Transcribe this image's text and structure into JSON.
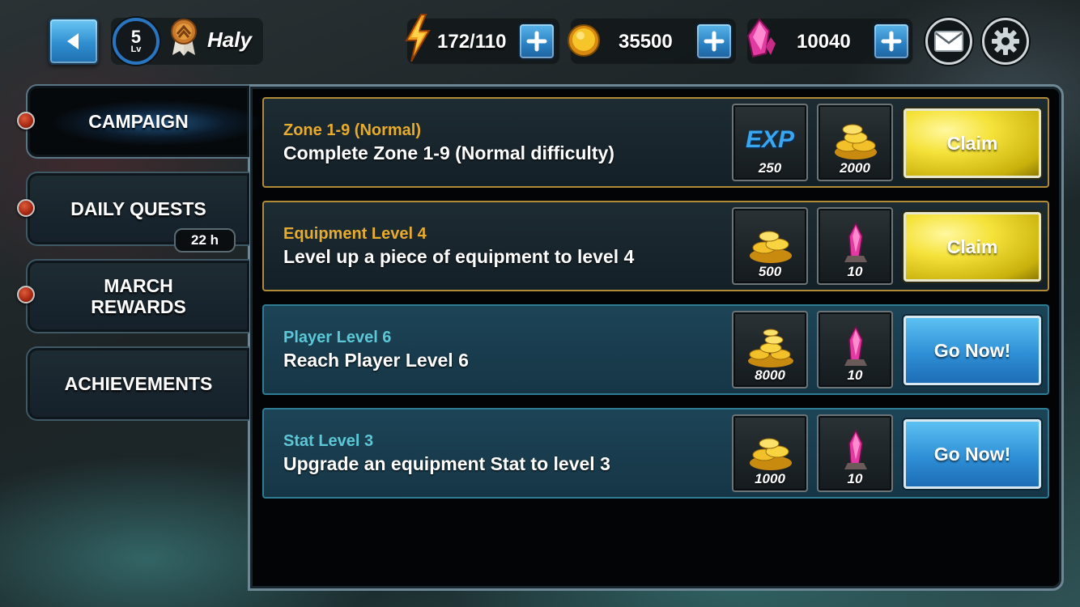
{
  "header": {
    "back_icon": "back-arrow-icon",
    "player": {
      "level": "5",
      "level_label": "Lv",
      "name": "Haly",
      "rank_icon": "rank-medal-icon"
    },
    "resources": [
      {
        "icon": "energy-bolt-icon",
        "value": "172/110"
      },
      {
        "icon": "gold-coin-icon",
        "value": "35500"
      },
      {
        "icon": "pink-gem-icon",
        "value": "10040"
      }
    ],
    "mail_icon": "mail-envelope-icon",
    "settings_icon": "gear-icon"
  },
  "tabs": [
    {
      "label": "CAMPAIGN",
      "active": true
    },
    {
      "label": "DAILY QUESTS",
      "timer": "22 h"
    },
    {
      "label": "MARCH REWARDS"
    },
    {
      "label": "ACHIEVEMENTS"
    }
  ],
  "quests": [
    {
      "title": "Zone 1-9 (Normal)",
      "description": "Complete Zone 1-9 (Normal difficulty)",
      "status": "claimable",
      "rewards": [
        {
          "type": "exp",
          "label": "EXP",
          "amount": "250"
        },
        {
          "type": "gold",
          "amount": "2000"
        }
      ],
      "button": "Claim"
    },
    {
      "title": "Equipment Level 4",
      "description": "Level up a piece of equipment to level 4",
      "status": "claimable",
      "rewards": [
        {
          "type": "gold",
          "amount": "500"
        },
        {
          "type": "gem",
          "amount": "10"
        }
      ],
      "button": "Claim"
    },
    {
      "title": "Player Level 6",
      "description": "Reach Player Level 6",
      "status": "in-progress",
      "rewards": [
        {
          "type": "gold",
          "amount": "8000"
        },
        {
          "type": "gem",
          "amount": "10"
        }
      ],
      "button": "Go Now!"
    },
    {
      "title": "Stat Level 3",
      "description": "Upgrade an equipment Stat to level 3",
      "status": "in-progress",
      "rewards": [
        {
          "type": "gold",
          "amount": "1000"
        },
        {
          "type": "gem",
          "amount": "10"
        }
      ],
      "button": "Go Now!"
    }
  ],
  "colors": {
    "claimable_title": "#e9ab2b",
    "in_progress_title": "#5cc7d6",
    "claim_button": "#f5e23a",
    "go_button": "#2f8fd6"
  }
}
